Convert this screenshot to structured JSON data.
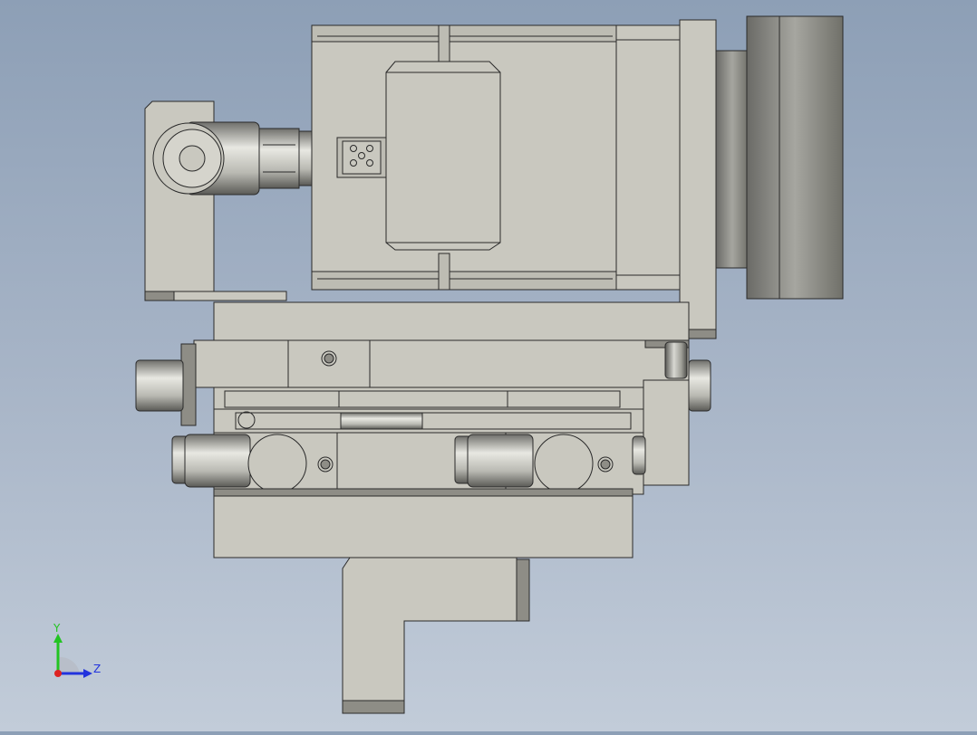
{
  "viewport": {
    "background_top": "#8d9fb6",
    "background_bottom": "#c2ccd9",
    "part_fill": "#c9c8bf",
    "part_edge": "#2a2a2a",
    "metal_dark": "#5e5e5a",
    "metal_light": "#e8e8e2"
  },
  "triad": {
    "y_label": "Y",
    "z_label": "Z",
    "y_color": "#22c422",
    "z_color": "#2233dd",
    "x_color": "#dd2222"
  }
}
